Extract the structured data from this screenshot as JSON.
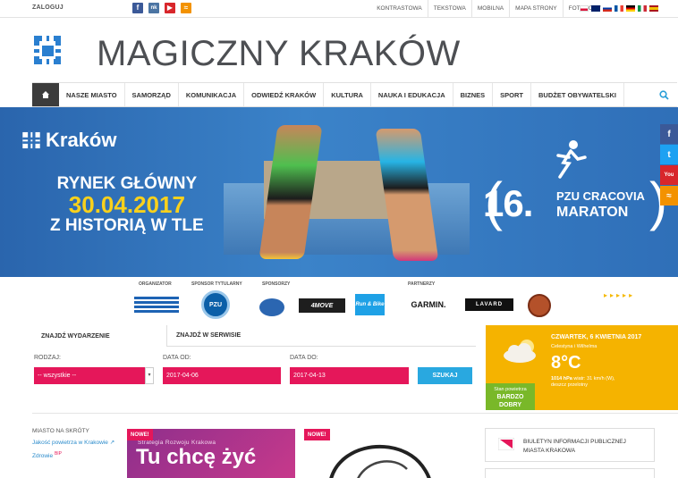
{
  "topbar": {
    "login": "ZALOGUJ",
    "links": [
      "KONTRASTOWA",
      "TEKSTOWA",
      "MOBILNA",
      "MAPA STRONY",
      "FOTOKODY"
    ]
  },
  "header": {
    "title": "MAGICZNY KRAKÓW"
  },
  "nav": {
    "items": [
      "NASZE MIASTO",
      "SAMORZĄD",
      "KOMUNIKACJA",
      "ODWIEDŹ KRAKÓW",
      "KULTURA",
      "NAUKA I EDUKACJA",
      "BIZNES",
      "SPORT",
      "BUDŻET OBYWATELSKI"
    ]
  },
  "banner": {
    "brand": "Kraków",
    "line1": "RYNEK GŁÓWNY",
    "date": "30.04.2017",
    "line3": "Z HISTORIĄ W TLE",
    "marathon_number": "16.",
    "marathon_sponsor": "PZU CRACOVIA",
    "marathon_name": "MARATON"
  },
  "sponsors": {
    "labels": [
      "ORGANIZATOR",
      "SPONSOR TYTULARNY",
      "SPONSORZY",
      "PARTNERZY"
    ],
    "logos": [
      "PZU",
      "4MOVE",
      "Run & Bike",
      "GARMIN.",
      "LAVARD"
    ]
  },
  "event_search": {
    "tab1": "ZNAJDŹ WYDARZENIE",
    "tab2": "ZNAJDŹ W SERWISIE",
    "category_label": "RODZAJ:",
    "category_value": "-- wszystkie --",
    "from_label": "DATA OD:",
    "from_value": "2017-04-06",
    "to_label": "DATA DO:",
    "to_value": "2017-04-13",
    "button": "SZUKAJ"
  },
  "weather": {
    "date": "CZWARTEK, 6 KWIETNIA 2017",
    "place": "Celestyna i Wilhelma",
    "temp": "8°C",
    "pressure_value": "1014 hPa",
    "wind": "wiatr: 31 km/h (W),",
    "condition": "deszcz przelotny",
    "air_label": "Stan powietrza",
    "air_quality": "BARDZO DOBRY"
  },
  "shortcuts": {
    "heading": "MIASTO NA SKRÓTY",
    "items": [
      "Jakość powietrza w Krakowie",
      "Zdrowie"
    ],
    "bip_sup": "BIP"
  },
  "promos": {
    "badge": "NOWE!",
    "strategy_small": "Strategia Rozwoju Krakowa",
    "strategy_big": "Tu chcę żyć"
  },
  "bip": {
    "line1": "BIULETYN INFORMACJI PUBLICZNEJ",
    "line2": "MIASTA KRAKOWA",
    "icon_text": "bip"
  },
  "colors": {
    "accent_blue": "#29a8e0",
    "accent_pink": "#e5175a",
    "weather_yellow": "#f5b300",
    "banner_blue": "#2f6fb8"
  }
}
